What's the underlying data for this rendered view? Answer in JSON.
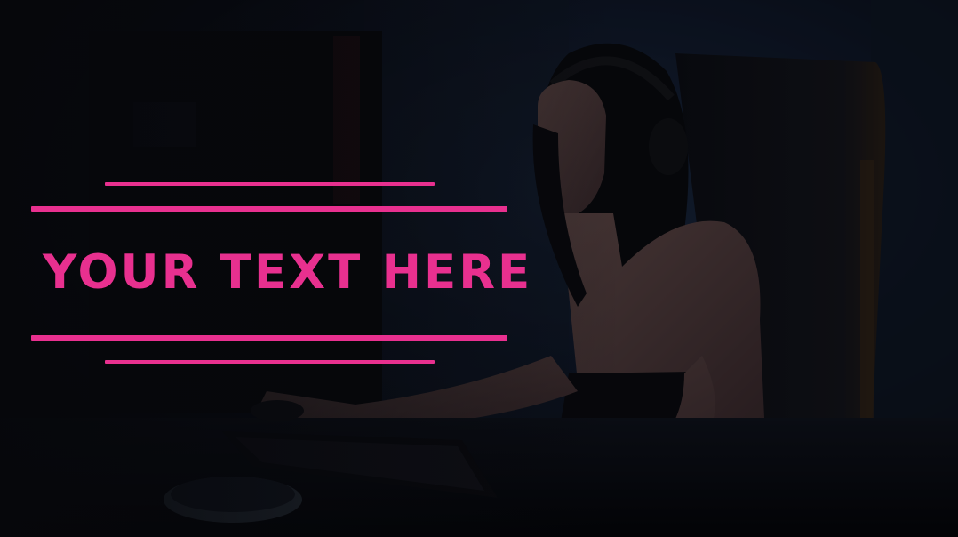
{
  "headline": {
    "text": "YOUR TEXT HERE"
  },
  "colors": {
    "accent": "#e8308f",
    "background": "#06070c"
  },
  "photo": {
    "subject": "woman-with-headphones-at-computer"
  }
}
